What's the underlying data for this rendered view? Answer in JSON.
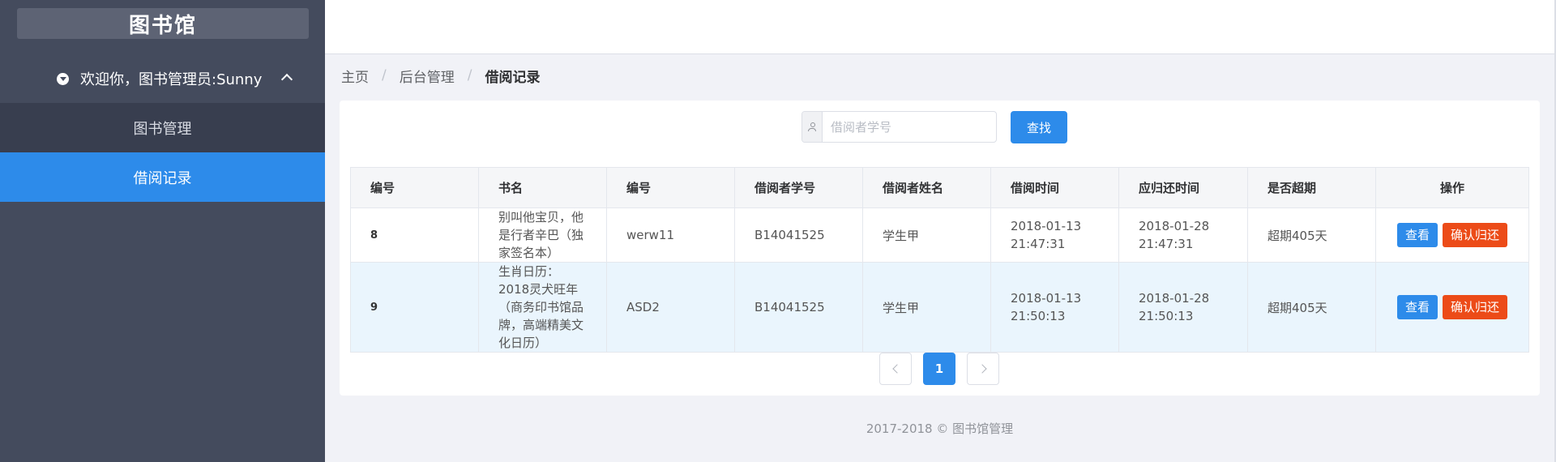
{
  "sidebar": {
    "logo": "图书馆",
    "welcome": "欢迎你，图书管理员:Sunny",
    "menu": {
      "books": "图书管理",
      "records": "借阅记录"
    }
  },
  "breadcrumb": {
    "home": "主页",
    "admin": "后台管理",
    "current": "借阅记录",
    "separator": "/"
  },
  "search": {
    "placeholder": "借阅者学号",
    "button": "查找"
  },
  "table": {
    "headers": [
      "编号",
      "书名",
      "编号",
      "借阅者学号",
      "借阅者姓名",
      "借阅时间",
      "应归还时间",
      "是否超期",
      "操作"
    ],
    "rows": [
      {
        "id": "8",
        "title": "别叫他宝贝，他是行者辛巴（独家签名本）",
        "book_no": "werw11",
        "student_no": "B14041525",
        "name": "学生甲",
        "borrow_time": "2018-01-13 21:47:31",
        "due_time": "2018-01-28 21:47:31",
        "overdue": "超期405天"
      },
      {
        "id": "9",
        "title": "生肖日历：2018灵犬旺年（商务印书馆品牌，高端精美文化日历）",
        "book_no": "ASD2",
        "student_no": "B14041525",
        "name": "学生甲",
        "borrow_time": "2018-01-13 21:50:13",
        "due_time": "2018-01-28 21:50:13",
        "overdue": "超期405天"
      }
    ],
    "actions": {
      "view": "查看",
      "return": "确认归还"
    }
  },
  "pagination": {
    "current_page": "1"
  },
  "footer": {
    "text": "2017-2018 © 图书馆管理"
  },
  "colors": {
    "sidebar_bg": "#444b5d",
    "accent": "#2d8bea",
    "danger": "#ec4b18",
    "row_highlight": "#eaf5fd"
  }
}
